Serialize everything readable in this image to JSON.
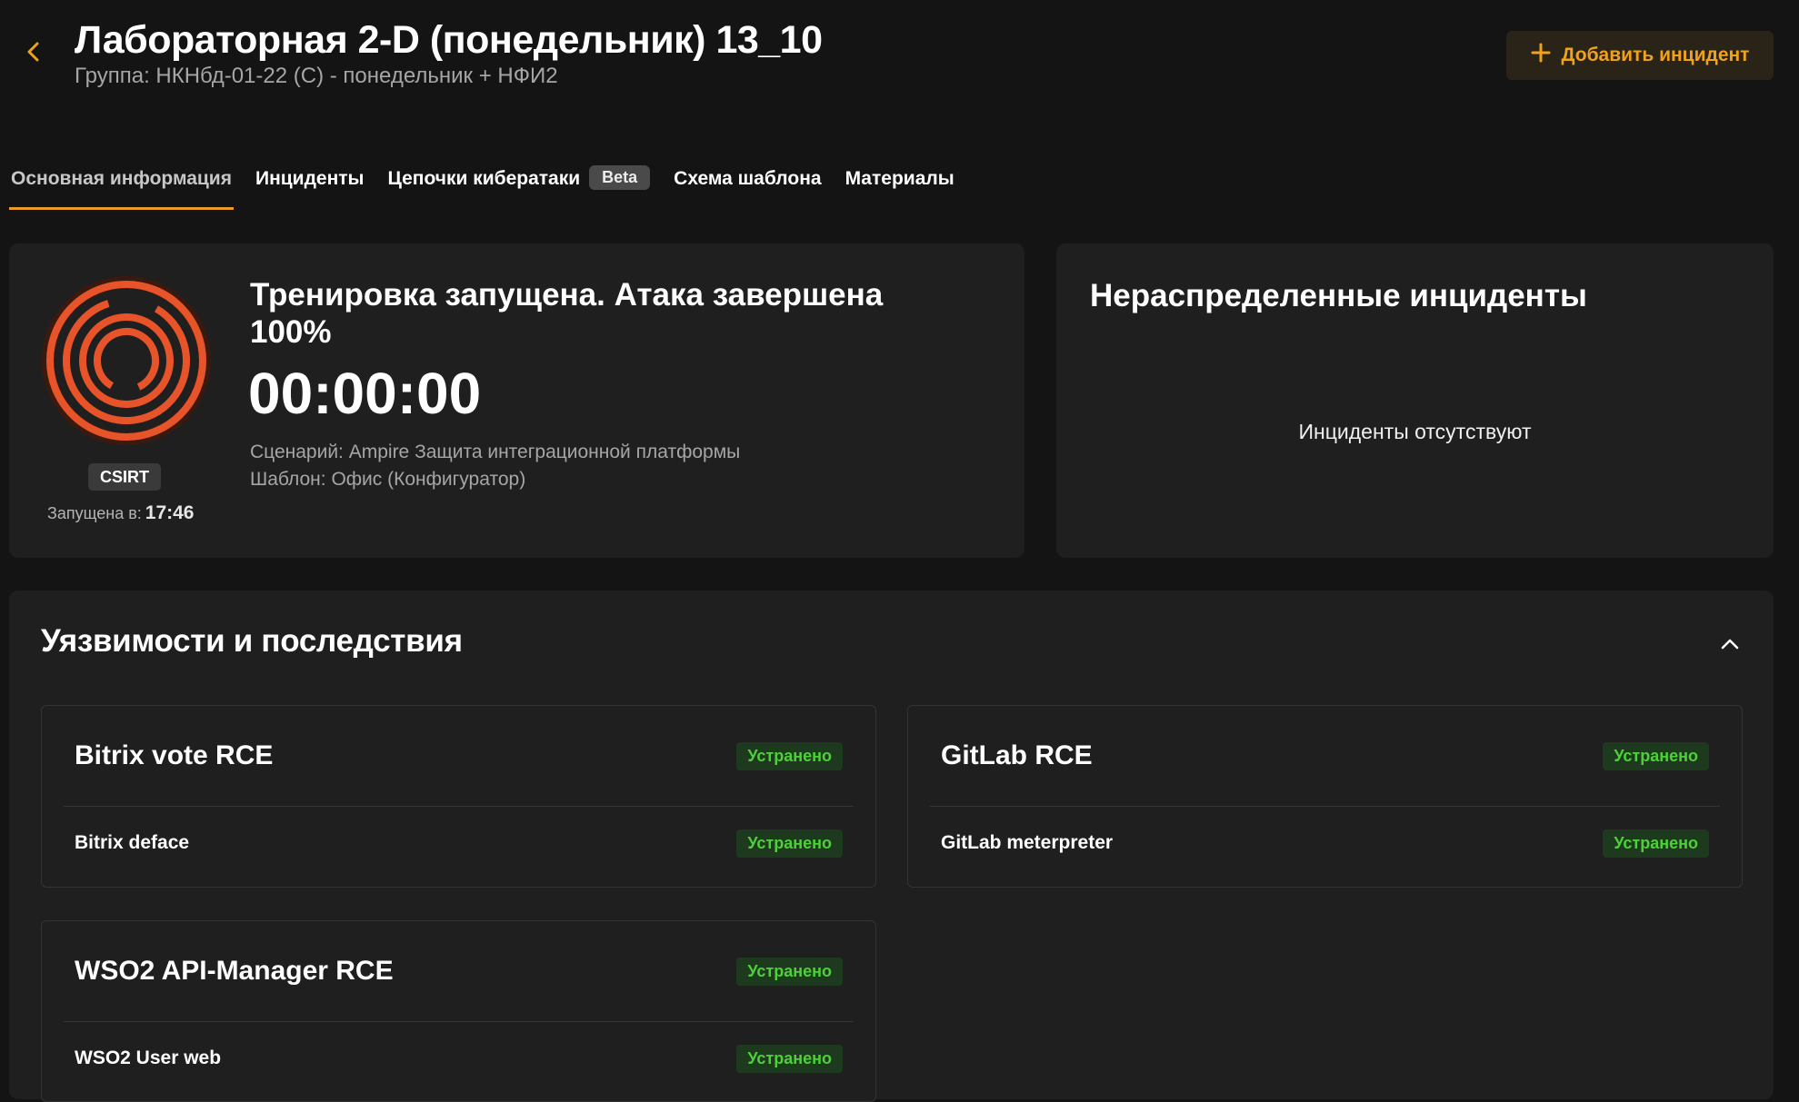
{
  "header": {
    "title": "Лабораторная 2-D (понедельник) 13_10",
    "subtitle": "Группа: НКНбд-01-22 (С) - понедельник + НФИ2",
    "add_incident_label": "Добавить инцидент",
    "back_icon": "chevron-left-icon",
    "accent_color": "#f0a21c"
  },
  "tabs": [
    {
      "label": "Основная информация",
      "active": true
    },
    {
      "label": "Инциденты"
    },
    {
      "label": "Цепочки кибератаки",
      "badge": "Beta"
    },
    {
      "label": "Схема шаблона"
    },
    {
      "label": "Материалы"
    }
  ],
  "status": {
    "team_badge": "CSIRT",
    "started_label": "Запущена в:",
    "started_time": "17:46",
    "title": "Тренировка запущена. Атака завершена 100%",
    "timer": "00:00:00",
    "scenario": "Сценарий: Ampire Защита интеграционной платформы",
    "template": "Шаблон: Офис (Конфигуратор)"
  },
  "unassigned": {
    "title": "Нераспределенные инциденты",
    "empty_text": "Инциденты отсутствуют"
  },
  "vulnerabilities": {
    "title": "Уязвимости и последствия",
    "groups": [
      {
        "name": "Bitrix vote RCE",
        "status": "Устранено",
        "consequences": [
          {
            "name": "Bitrix deface",
            "status": "Устранено"
          }
        ]
      },
      {
        "name": "GitLab RCE",
        "status": "Устранено",
        "consequences": [
          {
            "name": "GitLab meterpreter",
            "status": "Устранено"
          }
        ]
      },
      {
        "name": "WSO2 API-Manager RCE",
        "status": "Устранено",
        "consequences": [
          {
            "name": "WSO2 User web",
            "status": "Устранено"
          }
        ]
      }
    ]
  }
}
